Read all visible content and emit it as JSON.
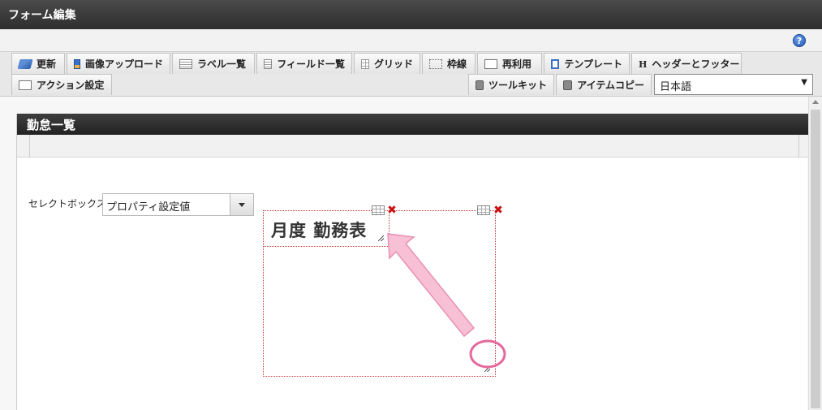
{
  "window": {
    "title": "フォーム編集"
  },
  "toolbar": {
    "tabs": [
      {
        "label": "更新",
        "icon": "update-icon"
      },
      {
        "label": "画像アップロード",
        "icon": "image-upload-icon"
      },
      {
        "label": "ラベル一覧",
        "icon": "label-list-icon"
      },
      {
        "label": "フィールド一覧",
        "icon": "field-list-icon"
      },
      {
        "label": "グリッド",
        "icon": "grid-icon"
      },
      {
        "label": "枠線",
        "icon": "border-icon"
      },
      {
        "label": "再利用",
        "icon": "reuse-icon"
      },
      {
        "label": "テンプレート",
        "icon": "template-icon"
      },
      {
        "label": "ヘッダーとフッター",
        "icon": "header-footer-icon",
        "glyph": "H"
      },
      {
        "label": "アクション設定",
        "icon": "action-icon"
      },
      {
        "label": "ツールキット",
        "icon": "toolkit-icon"
      },
      {
        "label": "アイテムコピー",
        "icon": "item-copy-icon"
      }
    ],
    "language": {
      "selected": "日本語",
      "arrow": "▼"
    },
    "help": "?"
  },
  "form": {
    "title": "勤怠一覧",
    "select_label": "セレクトボックス",
    "select_value": "プロパティ設定値",
    "label_item_text": "月度 勤務表",
    "delete_glyph": "✖"
  },
  "colors": {
    "annotation": "#e5679b",
    "arrow_fill": "#f8c0d4",
    "selection_border": "#c23333"
  }
}
